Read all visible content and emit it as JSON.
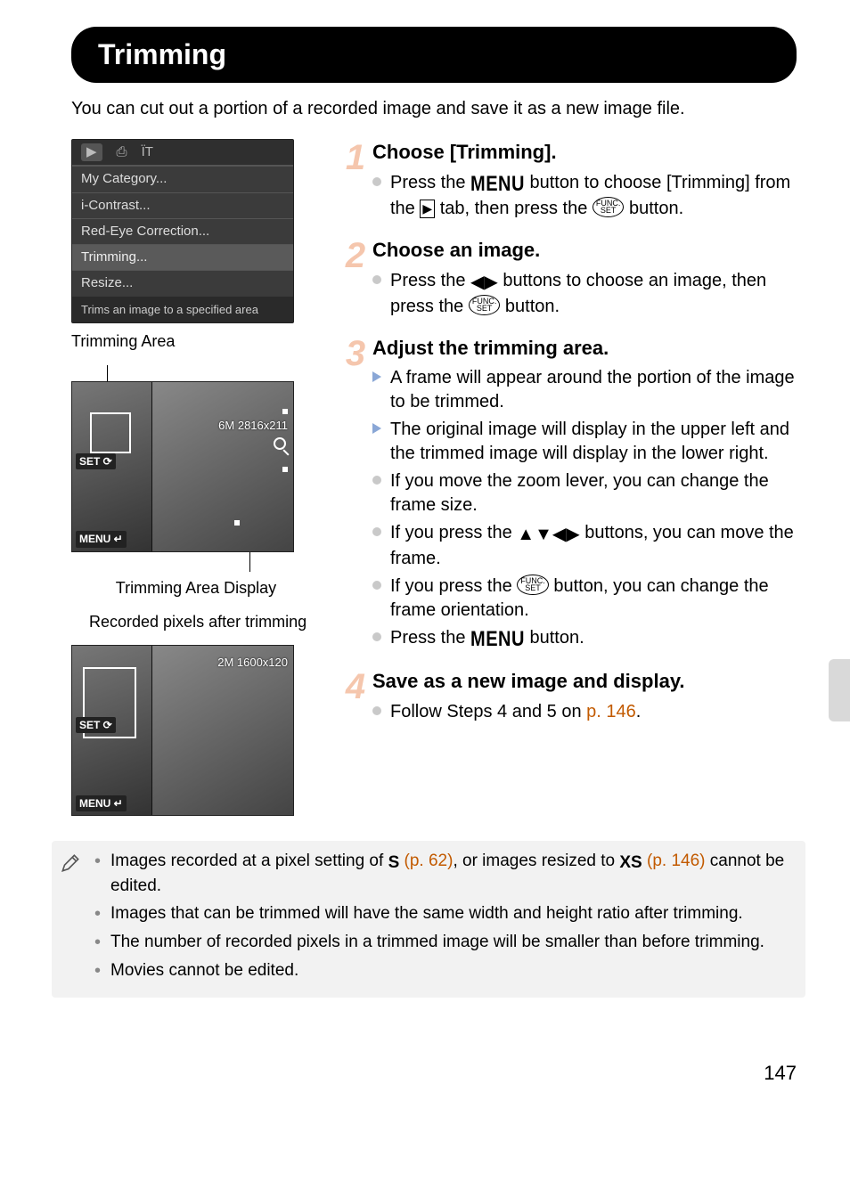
{
  "heading": "Trimming",
  "intro": "You can cut out a portion of a recorded image and save it as a new image file.",
  "menu": {
    "items": [
      "My Category...",
      "i-Contrast...",
      "Red-Eye Correction...",
      "Trimming...",
      "Resize..."
    ],
    "selected_index": 3,
    "caption": "Trims an image to a specified area"
  },
  "labels": {
    "trimming_area": "Trimming Area",
    "trimming_area_display": "Trimming Area Display",
    "recorded_pixels": "Recorded pixels after trimming",
    "set": "SET",
    "menu_badge": "MENU",
    "dim1": "6M 2816x211",
    "dim2": "2M 1600x120"
  },
  "steps": [
    {
      "num": "1",
      "title": "Choose [Trimming].",
      "items": [
        {
          "type": "circ",
          "segments": [
            "Press the ",
            {
              "g": "menu"
            },
            " button to choose [Trimming] from the ",
            {
              "g": "playtab"
            },
            " tab, then press the ",
            {
              "g": "funcset"
            },
            " button."
          ]
        }
      ]
    },
    {
      "num": "2",
      "title": "Choose an image.",
      "items": [
        {
          "type": "circ",
          "segments": [
            "Press the ",
            {
              "g": "lr"
            },
            " buttons to choose an image, then press the ",
            {
              "g": "funcset"
            },
            " button."
          ]
        }
      ]
    },
    {
      "num": "3",
      "title": "Adjust the trimming area.",
      "items": [
        {
          "type": "tri",
          "segments": [
            "A frame will appear around the portion of the image to be trimmed."
          ]
        },
        {
          "type": "tri",
          "segments": [
            "The original image will display in the upper left and the trimmed image will display in the lower right."
          ]
        },
        {
          "type": "circ",
          "segments": [
            "If you move the zoom lever, you can change the frame size."
          ]
        },
        {
          "type": "circ",
          "segments": [
            "If you press the ",
            {
              "g": "udlr"
            },
            " buttons, you can move the frame."
          ]
        },
        {
          "type": "circ",
          "segments": [
            "If you press the ",
            {
              "g": "funcset"
            },
            " button, you can change the frame orientation."
          ]
        },
        {
          "type": "circ",
          "segments": [
            "Press the ",
            {
              "g": "menu"
            },
            " button."
          ]
        }
      ]
    },
    {
      "num": "4",
      "title": "Save as a new image and display.",
      "items": [
        {
          "type": "circ",
          "segments": [
            "Follow Steps 4 and 5 on ",
            {
              "link": "p. 146"
            },
            "."
          ]
        }
      ]
    }
  ],
  "notes": [
    {
      "segments": [
        "Images recorded at a pixel setting of ",
        {
          "g": "s"
        },
        " ",
        {
          "link": "(p. 62)"
        },
        ", or images resized to ",
        {
          "g": "xs"
        },
        " ",
        {
          "link": "(p. 146)"
        },
        " cannot be edited."
      ]
    },
    {
      "segments": [
        "Images that can be trimmed will have the same width and height ratio after trimming."
      ]
    },
    {
      "segments": [
        "The number of recorded pixels in a trimmed image will be smaller than before trimming."
      ]
    },
    {
      "segments": [
        "Movies cannot be edited."
      ]
    }
  ],
  "page_number": "147",
  "glyph_text": {
    "menu": "MENU",
    "funcset_top": "FUNC.",
    "funcset_bottom": "SET",
    "playtab": "▶",
    "lr": "◀▶",
    "udlr": "▲▼◀▶",
    "s": "S",
    "xs": "XS"
  }
}
